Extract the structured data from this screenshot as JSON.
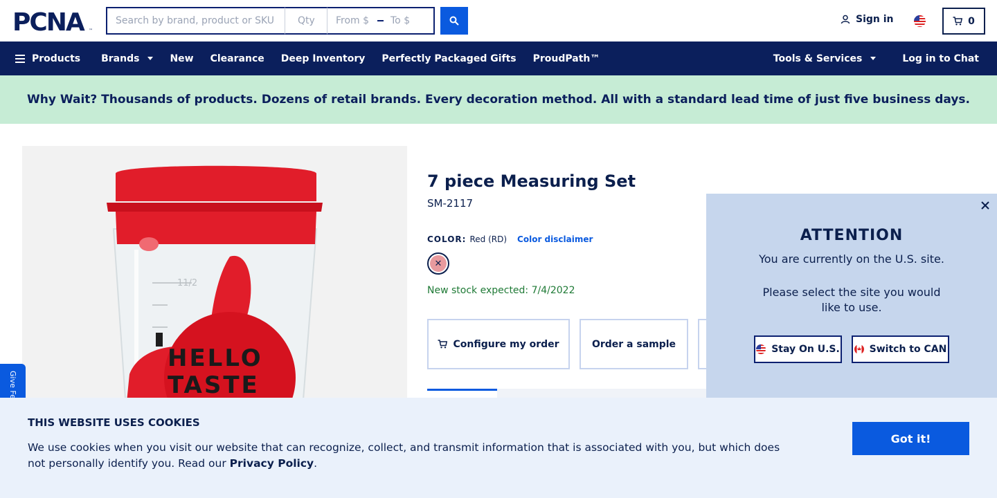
{
  "header": {
    "logo_text": "PCNA",
    "search_placeholder": "Search by brand, product or SKU",
    "qty_placeholder": "Qty",
    "price_from_placeholder": "From $",
    "price_to_placeholder": "To $",
    "signin_label": "Sign in",
    "cart_count": "0"
  },
  "nav": {
    "products": "Products",
    "brands": "Brands",
    "new": "New",
    "clearance": "Clearance",
    "deep_inventory": "Deep Inventory",
    "gifts": "Perfectly Packaged Gifts",
    "proudpath": "ProudPath™",
    "tools": "Tools & Services",
    "chat": "Log in to Chat"
  },
  "promo": {
    "text": "Why Wait? Thousands of products. Dozens of retail brands. Every decoration method. All with a standard lead time of just five business days."
  },
  "product": {
    "title": "7 piece Measuring Set",
    "sku": "SM-2117",
    "color_label": "COLOR:",
    "color_value": "Red (RD)",
    "color_disclaimer": "Color disclaimer",
    "swatch_color": "#e89a9e",
    "stock_note": "New stock expected: 7/4/2022",
    "configure_label": "Configure my order",
    "sample_label": "Order a sample",
    "image_text_line1": "HELLO",
    "image_text_line2": "TASTE",
    "image_measure": "11/2"
  },
  "feedback": {
    "label": "Give Fe"
  },
  "attention": {
    "title": "ATTENTION",
    "line1": "You are currently on the U.S. site.",
    "line2": "Please select the site you would like to use.",
    "stay_label": "Stay On U.S.",
    "switch_label": "Switch to CAN"
  },
  "cookies": {
    "title": "THIS WEBSITE USES COOKIES",
    "text": "We use cookies when you visit our website that can recognize, collect, and transmit information that is associated with you, but which does not personally identify you. Read our",
    "link": "Privacy Policy",
    "end": ".",
    "button": "Got it!"
  },
  "colors": {
    "brand_navy": "#0b1f5c",
    "accent_blue": "#0a5adf",
    "promo_green": "#c6ecd5",
    "product_red": "#e11d2a"
  }
}
